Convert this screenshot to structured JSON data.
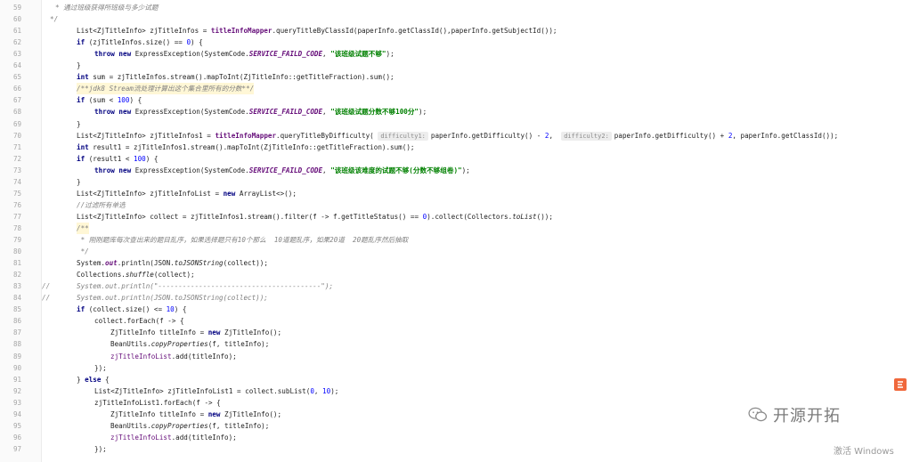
{
  "editor": {
    "lines": [
      {
        "n": "59",
        "segs": [
          {
            "t": "* 通过班级获得所班级与多少试题",
            "c": "cmt"
          }
        ],
        "indent": 1,
        "mark": ""
      },
      {
        "n": "60",
        "segs": [
          {
            "t": "*/",
            "c": "cmt"
          }
        ],
        "indent": 0,
        "mark": ""
      },
      {
        "n": "61",
        "segs": [
          {
            "t": "List<ZjTitleInfo> zjTitleInfos = ",
            "c": ""
          },
          {
            "t": "titleInfoMapper",
            "c": "field"
          },
          {
            "t": ".queryTitleByClassId(paperInfo.getClassId(),paperInfo.getSubjectId());",
            "c": ""
          }
        ],
        "indent": 2,
        "mark": ""
      },
      {
        "n": "62",
        "segs": [
          {
            "t": "if",
            "c": "kw"
          },
          {
            "t": " (zjTitleInfos.size() == ",
            "c": ""
          },
          {
            "t": "0",
            "c": "num"
          },
          {
            "t": ") {",
            "c": ""
          }
        ],
        "indent": 2,
        "mark": ""
      },
      {
        "n": "63",
        "segs": [
          {
            "t": "throw new",
            "c": "kw"
          },
          {
            "t": " ExpressException(SystemCode.",
            "c": ""
          },
          {
            "t": "SERVICE_FAILD_CODE",
            "c": "const"
          },
          {
            "t": ", ",
            "c": ""
          },
          {
            "t": "\"该班级试题不够\"",
            "c": "str"
          },
          {
            "t": ");",
            "c": ""
          }
        ],
        "indent": 3,
        "mark": ""
      },
      {
        "n": "64",
        "segs": [
          {
            "t": "}",
            "c": ""
          }
        ],
        "indent": 2,
        "mark": ""
      },
      {
        "n": "65",
        "segs": [
          {
            "t": "int",
            "c": "kw"
          },
          {
            "t": " sum = zjTitleInfos.stream().mapToInt(ZjTitleInfo::getTitleFraction).sum();",
            "c": ""
          }
        ],
        "indent": 2,
        "mark": ""
      },
      {
        "n": "66",
        "segs": [
          {
            "t": "/**jdk8 Stream流处理计算出这个集合里所有的分数**/",
            "c": "cmt"
          }
        ],
        "indent": 2,
        "mark": "hl"
      },
      {
        "n": "67",
        "segs": [
          {
            "t": "if",
            "c": "kw"
          },
          {
            "t": " (sum < ",
            "c": ""
          },
          {
            "t": "100",
            "c": "num"
          },
          {
            "t": ") {",
            "c": ""
          }
        ],
        "indent": 2,
        "mark": ""
      },
      {
        "n": "68",
        "segs": [
          {
            "t": "throw new",
            "c": "kw"
          },
          {
            "t": " ExpressException(SystemCode.",
            "c": ""
          },
          {
            "t": "SERVICE_FAILD_CODE",
            "c": "const"
          },
          {
            "t": ", ",
            "c": ""
          },
          {
            "t": "\"该班级试题分数不够100分\"",
            "c": "str"
          },
          {
            "t": ");",
            "c": ""
          }
        ],
        "indent": 3,
        "mark": ""
      },
      {
        "n": "69",
        "segs": [
          {
            "t": "}",
            "c": ""
          }
        ],
        "indent": 2,
        "mark": ""
      },
      {
        "n": "70",
        "segs": [
          {
            "t": "List<ZjTitleInfo> zjTitleInfos1 = ",
            "c": ""
          },
          {
            "t": "titleInfoMapper",
            "c": "field"
          },
          {
            "t": ".queryTitleByDifficulty( ",
            "c": ""
          },
          {
            "t": "difficulty1:",
            "c": "hint"
          },
          {
            "t": "paperInfo.getDifficulty() - ",
            "c": ""
          },
          {
            "t": "2",
            "c": "num"
          },
          {
            "t": ",  ",
            "c": ""
          },
          {
            "t": "difficulty2:",
            "c": "hint"
          },
          {
            "t": "paperInfo.getDifficulty() + ",
            "c": ""
          },
          {
            "t": "2",
            "c": "num"
          },
          {
            "t": ", paperInfo.getClassId());",
            "c": ""
          }
        ],
        "indent": 2,
        "mark": ""
      },
      {
        "n": "71",
        "segs": [
          {
            "t": "int",
            "c": "kw"
          },
          {
            "t": " result1 = zjTitleInfos1.stream().mapToInt(ZjTitleInfo::getTitleFraction).sum();",
            "c": ""
          }
        ],
        "indent": 2,
        "mark": ""
      },
      {
        "n": "72",
        "segs": [
          {
            "t": "if",
            "c": "kw"
          },
          {
            "t": " (result1 < ",
            "c": ""
          },
          {
            "t": "100",
            "c": "num"
          },
          {
            "t": ") {",
            "c": ""
          }
        ],
        "indent": 2,
        "mark": ""
      },
      {
        "n": "73",
        "segs": [
          {
            "t": "throw new",
            "c": "kw"
          },
          {
            "t": " ExpressException(SystemCode.",
            "c": ""
          },
          {
            "t": "SERVICE_FAILD_CODE",
            "c": "const"
          },
          {
            "t": ", ",
            "c": ""
          },
          {
            "t": "\"该班级该难度的试题不够(分数不够组卷)\"",
            "c": "str"
          },
          {
            "t": ");",
            "c": ""
          }
        ],
        "indent": 3,
        "mark": ""
      },
      {
        "n": "74",
        "segs": [
          {
            "t": "}",
            "c": ""
          }
        ],
        "indent": 2,
        "mark": ""
      },
      {
        "n": "75",
        "segs": [
          {
            "t": "List<ZjTitleInfo> zjTitleInfoList = ",
            "c": ""
          },
          {
            "t": "new",
            "c": "kw"
          },
          {
            "t": " ArrayList<>();",
            "c": ""
          }
        ],
        "indent": 2,
        "mark": ""
      },
      {
        "n": "76",
        "segs": [
          {
            "t": "//过滤所有单选",
            "c": "cmt"
          }
        ],
        "indent": 2,
        "mark": ""
      },
      {
        "n": "77",
        "segs": [
          {
            "t": "List<ZjTitleInfo> collect = zjTitleInfos1.stream().filter(f -> f.getTitleStatus() == ",
            "c": ""
          },
          {
            "t": "0",
            "c": "num"
          },
          {
            "t": ").collect(Collectors.",
            "c": ""
          },
          {
            "t": "toList",
            "c": "static-fn"
          },
          {
            "t": "());",
            "c": ""
          }
        ],
        "indent": 2,
        "mark": ""
      },
      {
        "n": "78",
        "segs": [
          {
            "t": "/**",
            "c": "cmt"
          }
        ],
        "indent": 2,
        "mark": "hl"
      },
      {
        "n": "79",
        "segs": [
          {
            "t": " * 刚刚题库每次查出来的题目乱序，如果选择题只有10个那么  10道题乱序，如果20道  20题乱序然后抽取",
            "c": "cmt"
          }
        ],
        "indent": 2,
        "mark": ""
      },
      {
        "n": "80",
        "segs": [
          {
            "t": " */",
            "c": "cmt"
          }
        ],
        "indent": 2,
        "mark": ""
      },
      {
        "n": "81",
        "segs": [
          {
            "t": "System.",
            "c": ""
          },
          {
            "t": "out",
            "c": "const"
          },
          {
            "t": ".println(JSON.",
            "c": ""
          },
          {
            "t": "toJSONString",
            "c": "static-fn"
          },
          {
            "t": "(collect));",
            "c": ""
          }
        ],
        "indent": 2,
        "mark": ""
      },
      {
        "n": "82",
        "segs": [
          {
            "t": "Collections.",
            "c": ""
          },
          {
            "t": "shuffle",
            "c": "static-fn"
          },
          {
            "t": "(collect);",
            "c": ""
          }
        ],
        "indent": 2,
        "mark": ""
      },
      {
        "n": "83",
        "segs": [
          {
            "t": "System.out.println(\"----------------------------------------\");",
            "c": "cmt"
          }
        ],
        "indent": 2,
        "mark": "",
        "cm": "//"
      },
      {
        "n": "84",
        "segs": [
          {
            "t": "System.out.println(JSON.toJSONString(collect));",
            "c": "cmt"
          }
        ],
        "indent": 2,
        "mark": "",
        "cm": "//"
      },
      {
        "n": "85",
        "segs": [
          {
            "t": "if",
            "c": "kw"
          },
          {
            "t": " (collect.size() <= ",
            "c": ""
          },
          {
            "t": "10",
            "c": "num"
          },
          {
            "t": ") {",
            "c": ""
          }
        ],
        "indent": 2,
        "mark": ""
      },
      {
        "n": "86",
        "segs": [
          {
            "t": "collect.forEach(f -> {",
            "c": ""
          }
        ],
        "indent": 3,
        "mark": ""
      },
      {
        "n": "87",
        "segs": [
          {
            "t": "ZjTitleInfo titleInfo = ",
            "c": ""
          },
          {
            "t": "new",
            "c": "kw"
          },
          {
            "t": " ZjTitleInfo();",
            "c": ""
          }
        ],
        "indent": 4,
        "mark": ""
      },
      {
        "n": "88",
        "segs": [
          {
            "t": "BeanUtils.",
            "c": ""
          },
          {
            "t": "copyProperties",
            "c": "static-fn"
          },
          {
            "t": "(f, titleInfo);",
            "c": ""
          }
        ],
        "indent": 4,
        "mark": ""
      },
      {
        "n": "89",
        "segs": [
          {
            "t": "zjTitleInfoList",
            "c": "fieldv"
          },
          {
            "t": ".add(titleInfo);",
            "c": ""
          }
        ],
        "indent": 4,
        "mark": ""
      },
      {
        "n": "90",
        "segs": [
          {
            "t": "});",
            "c": ""
          }
        ],
        "indent": 3,
        "mark": ""
      },
      {
        "n": "91",
        "segs": [
          {
            "t": "} ",
            "c": ""
          },
          {
            "t": "else",
            "c": "kw"
          },
          {
            "t": " {",
            "c": ""
          }
        ],
        "indent": 2,
        "mark": ""
      },
      {
        "n": "92",
        "segs": [
          {
            "t": "List<ZjTitleInfo> zjTitleInfoList1 = collect.subList(",
            "c": ""
          },
          {
            "t": "0",
            "c": "num"
          },
          {
            "t": ", ",
            "c": ""
          },
          {
            "t": "10",
            "c": "num"
          },
          {
            "t": ");",
            "c": ""
          }
        ],
        "indent": 3,
        "mark": ""
      },
      {
        "n": "93",
        "segs": [
          {
            "t": "zjTitleInfoList1.forEach(f -> {",
            "c": ""
          }
        ],
        "indent": 3,
        "mark": ""
      },
      {
        "n": "94",
        "segs": [
          {
            "t": "ZjTitleInfo titleInfo = ",
            "c": ""
          },
          {
            "t": "new",
            "c": "kw"
          },
          {
            "t": " ZjTitleInfo();",
            "c": ""
          }
        ],
        "indent": 4,
        "mark": ""
      },
      {
        "n": "95",
        "segs": [
          {
            "t": "BeanUtils.",
            "c": ""
          },
          {
            "t": "copyProperties",
            "c": "static-fn"
          },
          {
            "t": "(f, titleInfo);",
            "c": ""
          }
        ],
        "indent": 4,
        "mark": ""
      },
      {
        "n": "96",
        "segs": [
          {
            "t": "zjTitleInfoList",
            "c": "fieldv"
          },
          {
            "t": ".add(titleInfo);",
            "c": ""
          }
        ],
        "indent": 4,
        "mark": ""
      },
      {
        "n": "97",
        "segs": [
          {
            "t": "});",
            "c": ""
          }
        ],
        "indent": 3,
        "mark": ""
      }
    ]
  },
  "watermark": {
    "brand_text": "开源开拓",
    "brand_icon": "wechat-icon"
  },
  "system": {
    "activate_text": "激活 Windows"
  },
  "colors": {
    "keyword": "#000080",
    "field": "#660e7a",
    "string": "#008000",
    "number": "#0000ff",
    "comment": "#808080"
  }
}
